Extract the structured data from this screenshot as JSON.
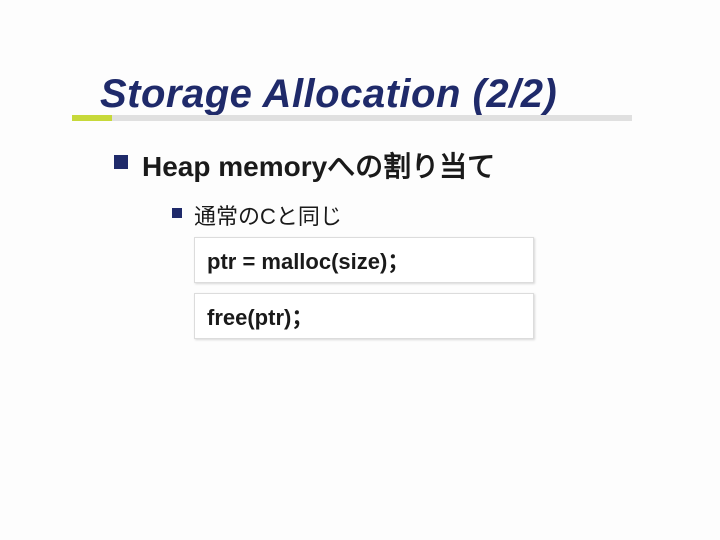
{
  "title": "Storage Allocation (2/2)",
  "level1": {
    "text": "Heap memoryへの割り当て"
  },
  "level2": {
    "text": "通常のCと同じ"
  },
  "code": {
    "line1": "ptr = malloc(size)；",
    "line2": "free(ptr)；"
  }
}
